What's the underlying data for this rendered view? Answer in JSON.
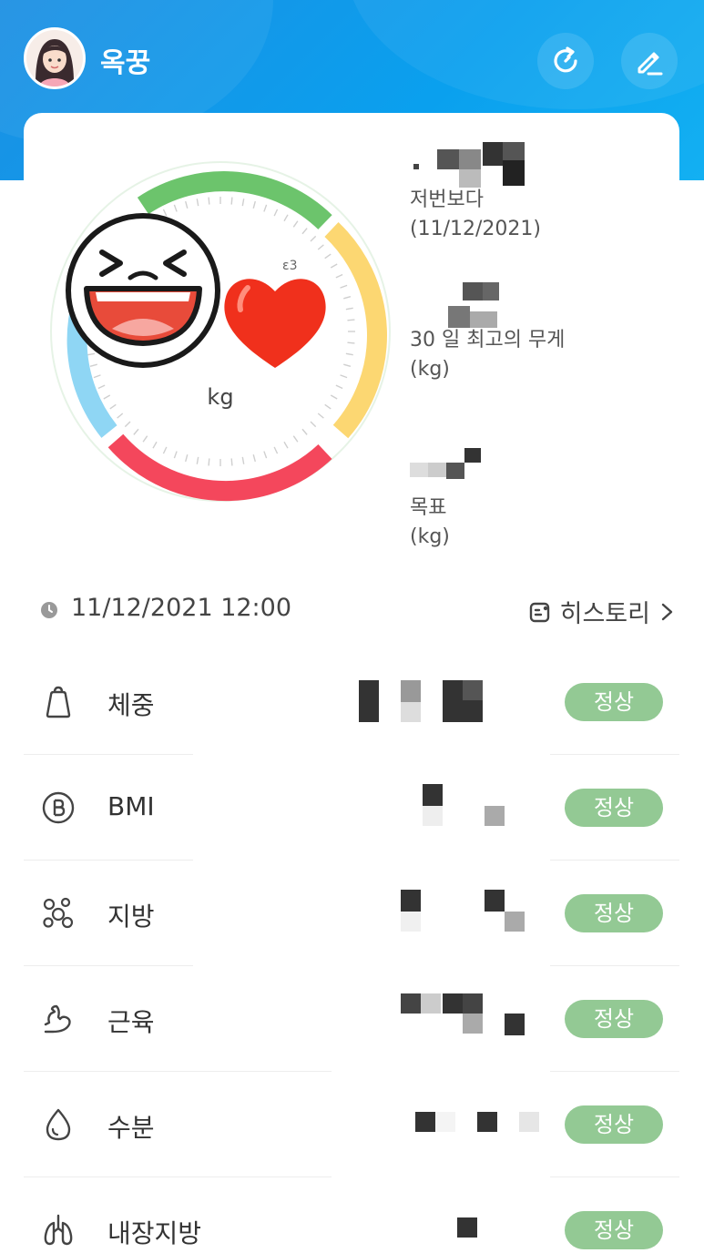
{
  "header": {
    "user_name": "옥꿍",
    "refresh_icon": "refresh-icon",
    "edit_icon": "edit-icon"
  },
  "summary": {
    "gauge_unit": "kg",
    "previous_label": "저번보다",
    "previous_date": "(11/12/2021)",
    "max_label": "30 일 최고의 무게",
    "max_unit": "(kg)",
    "goal_label": "목표",
    "goal_unit": "(kg)"
  },
  "measurement": {
    "datetime": "11/12/2021 12:00",
    "history_label": "히스토리"
  },
  "metrics": [
    {
      "label": "체중",
      "icon": "weight-icon",
      "status": "정상"
    },
    {
      "label": "BMI",
      "icon": "bmi-icon",
      "status": "정상"
    },
    {
      "label": "지방",
      "icon": "fat-icon",
      "status": "정상"
    },
    {
      "label": "근육",
      "icon": "muscle-icon",
      "status": "정상"
    },
    {
      "label": "수분",
      "icon": "water-icon",
      "status": "정상"
    },
    {
      "label": "내장지방",
      "icon": "lungs-icon",
      "status": "정상"
    }
  ],
  "colors": {
    "header": "#1c8fe3",
    "badge": "#93c994",
    "gauge_green": "#6cc46c",
    "gauge_yellow": "#fcd772",
    "gauge_red": "#f4475c",
    "gauge_blue": "#8fd6f4"
  }
}
